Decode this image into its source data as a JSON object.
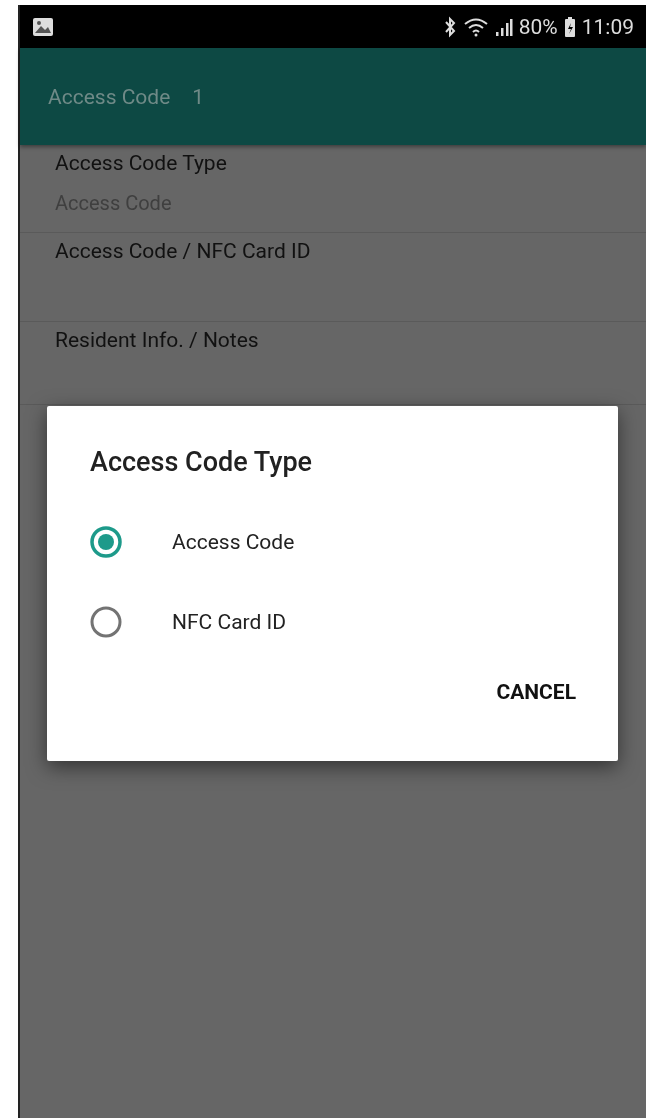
{
  "status_bar": {
    "battery": "80%",
    "time": "11:09"
  },
  "app_bar": {
    "title": "Access Code",
    "number": "1"
  },
  "fields": [
    {
      "label": "Access Code Type",
      "value": "Access Code"
    },
    {
      "label": "Access Code / NFC Card ID"
    },
    {
      "label": "Resident Info. / Notes"
    }
  ],
  "dialog": {
    "title": "Access Code Type",
    "options": [
      {
        "label": "Access Code",
        "selected": true
      },
      {
        "label": "NFC Card ID",
        "selected": false
      }
    ],
    "buttons": [
      "CANCEL"
    ]
  }
}
